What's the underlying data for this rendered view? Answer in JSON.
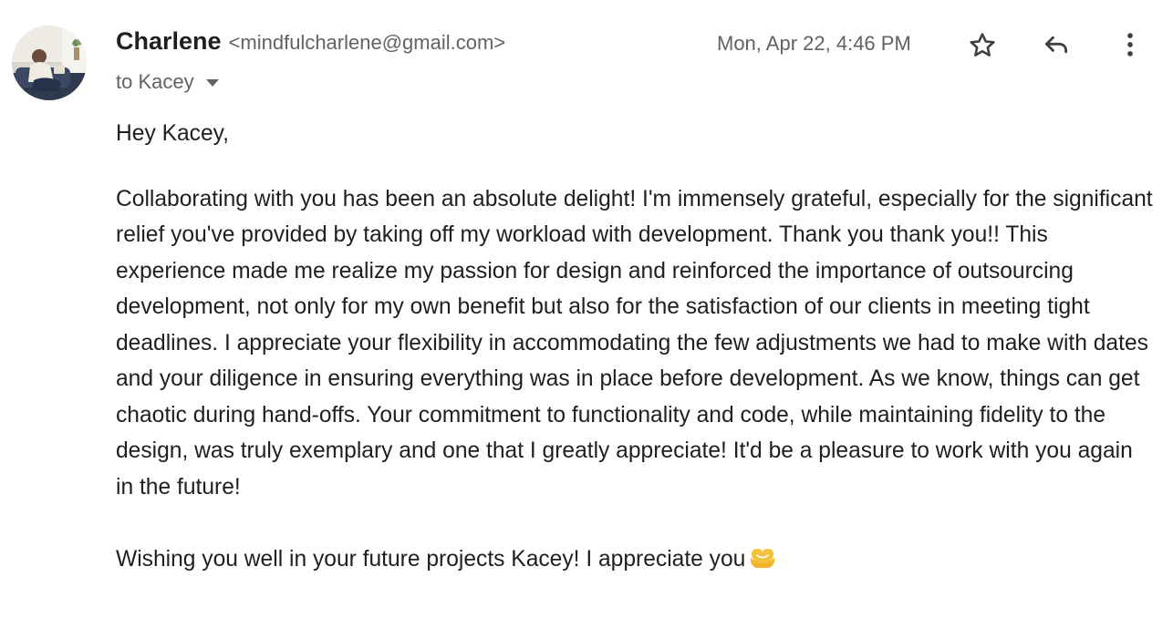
{
  "sender": {
    "name": "Charlene",
    "email": "<mindfulcharlene@gmail.com>"
  },
  "recipient": {
    "label": "to Kacey"
  },
  "date": "Mon, Apr 22, 4:46 PM",
  "toolbar": {
    "star_icon": "star-outline-icon",
    "reply_icon": "reply-icon",
    "more_icon": "more-vert-icon"
  },
  "message": {
    "greeting": "Hey Kacey,",
    "paragraph": "Collaborating with you has been an absolute delight! I'm immensely grateful, especially for the significant relief you've provided by taking off my workload with development. Thank you thank you!! This experience made me realize my passion for design and reinforced the importance of outsourcing development, not only for my own benefit but also for the satisfaction of our clients in meeting tight deadlines. I appreciate your flexibility in accommodating the few adjustments we had to make with dates and your diligence in ensuring everything was in place before development. As we know, things can get chaotic during hand-offs. Your commitment to functionality and code, while maintaining fidelity to the design, was truly exemplary and one that I greatly appreciate! It'd be a pleasure to work with you again in the future!",
    "closing": "Wishing you well in your future projects Kacey! I appreciate you",
    "closing_emoji": "heart-hands-emoji"
  },
  "colors": {
    "text": "#1f1f1f",
    "secondary": "#5f6368",
    "emoji": "#f5c33b"
  }
}
